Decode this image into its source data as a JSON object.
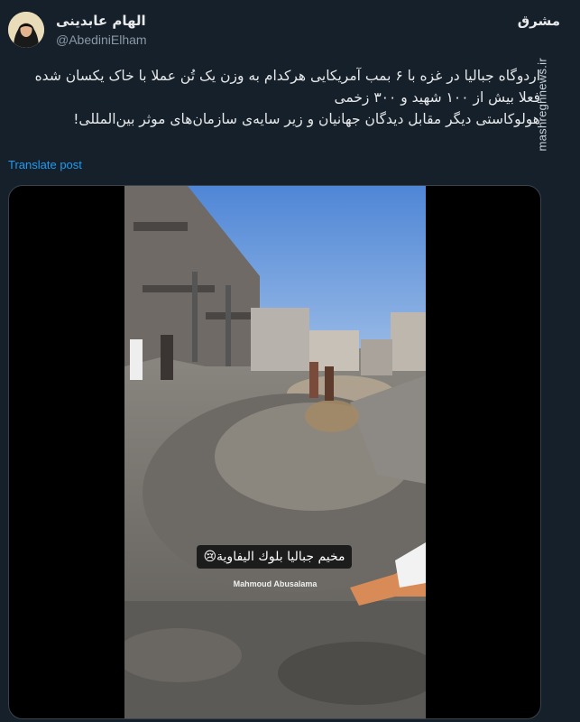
{
  "author": {
    "name": "الهام عابدینی",
    "handle": "@AbediniElham"
  },
  "watermark": {
    "logo": "مشرق",
    "site": "mashreghnews.ir"
  },
  "tweet": {
    "lines": [
      "اردوگاه جبالیا در غزه با ۶ بمب آمریکایی هرکدام به وزن یک تُن عملا با خاک یکسان شده",
      "فعلا بیش از ۱۰۰ شهید و ۳۰۰ زخمی",
      "هولوکاستی دیگر مقابل دیدگان جهانیان و زیر سایه‌ی سازمان‌های موثر بین‌المللی!"
    ],
    "translate_label": "Translate post"
  },
  "media": {
    "caption": "مخیم جبالیا بلوك اليفاوية😢",
    "credit": "Mahmoud Abusalama"
  }
}
